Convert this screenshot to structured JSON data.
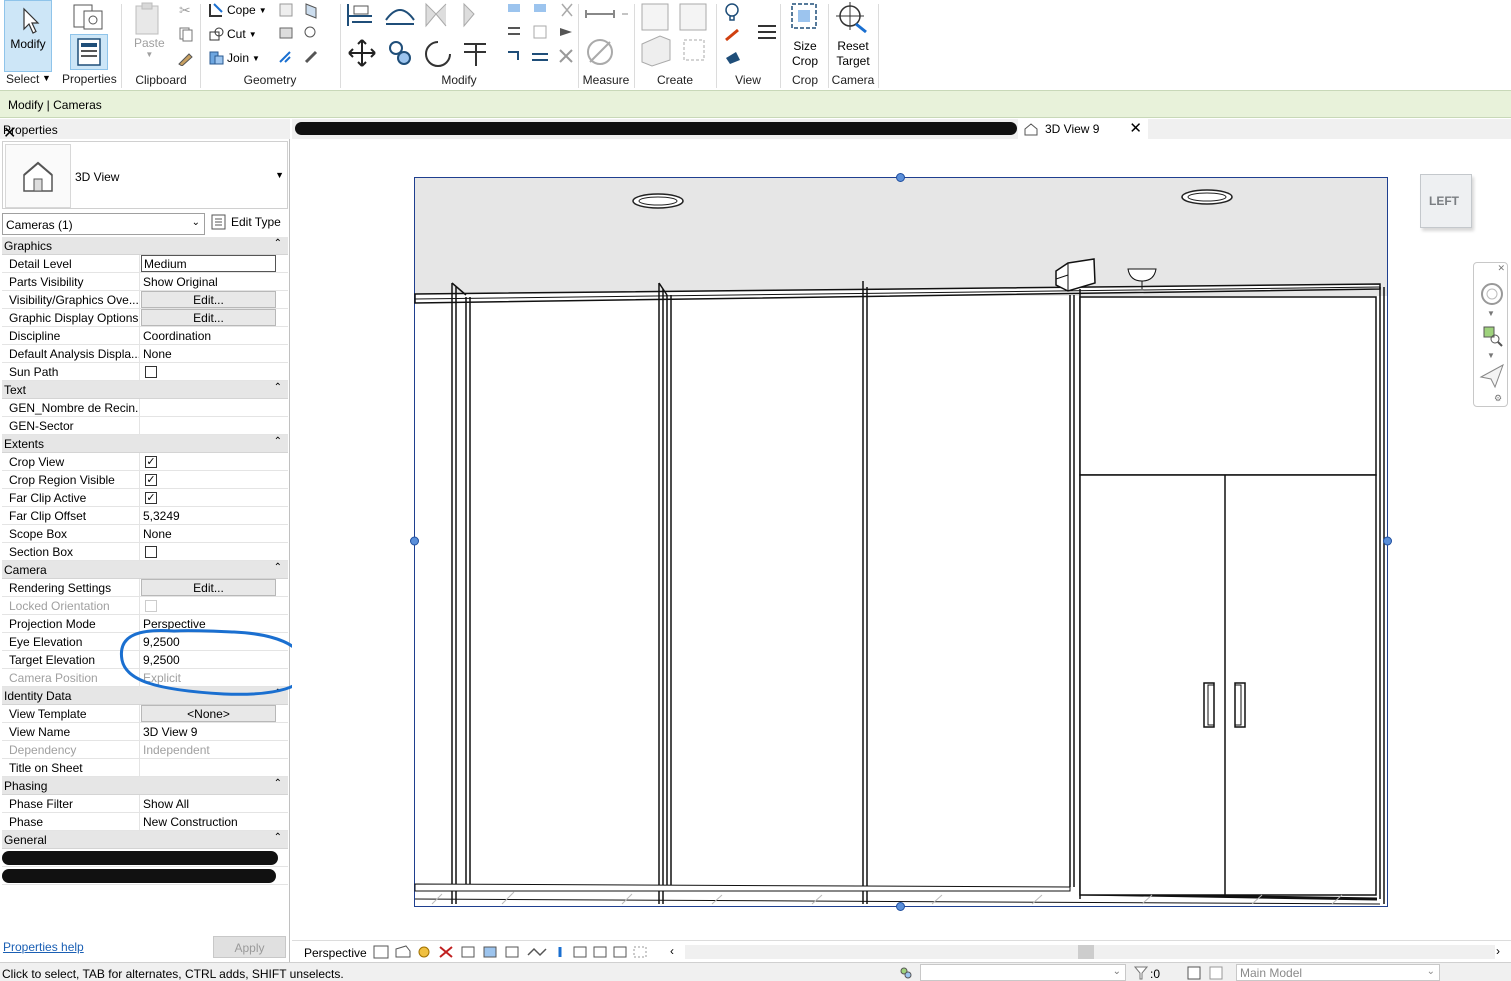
{
  "ribbon": {
    "modify_label": "Modify",
    "select_label": "Select",
    "properties_label": "Properties",
    "clipboard": {
      "paste_label": "Paste",
      "panel_label": "Clipboard"
    },
    "geometry": {
      "cope_label": "Cope",
      "cut_label": "Cut",
      "join_label": "Join",
      "panel_label": "Geometry"
    },
    "modify_panel_label": "Modify",
    "measure_panel_label": "Measure",
    "create_panel_label": "Create",
    "view_panel_label": "View",
    "crop": {
      "size_crop_line1": "Size",
      "size_crop_line2": "Crop",
      "panel_label": "Crop"
    },
    "camera": {
      "reset_target_line1": "Reset",
      "reset_target_line2": "Target",
      "panel_label": "Camera"
    }
  },
  "context_bar": {
    "text": "Modify | Cameras"
  },
  "properties": {
    "title": "Properties",
    "type_name": "3D View",
    "instance_filter": "Cameras (1)",
    "edit_type_label": "Edit Type",
    "groups": {
      "graphics": "Graphics",
      "text": "Text",
      "extents": "Extents",
      "camera": "Camera",
      "identity": "Identity Data",
      "phasing": "Phasing",
      "general": "General"
    },
    "rows": {
      "detail_level": {
        "k": "Detail Level",
        "v": "Medium"
      },
      "parts_visibility": {
        "k": "Parts Visibility",
        "v": "Show Original"
      },
      "vg_overrides": {
        "k": "Visibility/Graphics Ove...",
        "v": "Edit..."
      },
      "graphic_display": {
        "k": "Graphic Display Options",
        "v": "Edit..."
      },
      "discipline": {
        "k": "Discipline",
        "v": "Coordination"
      },
      "default_analysis": {
        "k": "Default Analysis Displa...",
        "v": "None"
      },
      "sun_path": {
        "k": "Sun Path"
      },
      "gen_nombre": {
        "k": "GEN_Nombre de Recin...",
        "v": ""
      },
      "gen_sector": {
        "k": "GEN-Sector",
        "v": ""
      },
      "crop_view": {
        "k": "Crop View",
        "v": "✓"
      },
      "crop_region_visible": {
        "k": "Crop Region Visible",
        "v": "✓"
      },
      "far_clip_active": {
        "k": "Far Clip Active",
        "v": "✓"
      },
      "far_clip_offset": {
        "k": "Far Clip Offset",
        "v": "5,3249"
      },
      "scope_box": {
        "k": "Scope Box",
        "v": "None"
      },
      "section_box": {
        "k": "Section Box"
      },
      "rendering_settings": {
        "k": "Rendering Settings",
        "v": "Edit..."
      },
      "locked_orientation": {
        "k": "Locked Orientation"
      },
      "projection_mode": {
        "k": "Projection Mode",
        "v": "Perspective"
      },
      "eye_elevation": {
        "k": "Eye Elevation",
        "v": "9,2500"
      },
      "target_elevation": {
        "k": "Target Elevation",
        "v": "9,2500"
      },
      "camera_position": {
        "k": "Camera Position",
        "v": "Explicit"
      },
      "view_template": {
        "k": "View Template",
        "v": "<None>"
      },
      "view_name": {
        "k": "View Name",
        "v": "3D View 9"
      },
      "dependency": {
        "k": "Dependency",
        "v": "Independent"
      },
      "title_on_sheet": {
        "k": "Title on Sheet",
        "v": ""
      },
      "phase_filter": {
        "k": "Phase Filter",
        "v": "Show All"
      },
      "phase": {
        "k": "Phase",
        "v": "New Construction"
      }
    },
    "help_link": "Properties help",
    "apply_label": "Apply"
  },
  "view": {
    "tab_title": "3D View 9",
    "viewcube_face": "LEFT",
    "projection_label": "Perspective"
  },
  "status": {
    "hint": "Click to select, TAB for alternates, CTRL adds, SHIFT unselects.",
    "selection_count": ":0",
    "active_model": "Main Model"
  },
  "colors": {
    "ribbon_context": "#e8f2da",
    "modify_active": "#cde6f7",
    "annotation_circle": "#1a6fd0",
    "link": "#1a5fb4"
  }
}
